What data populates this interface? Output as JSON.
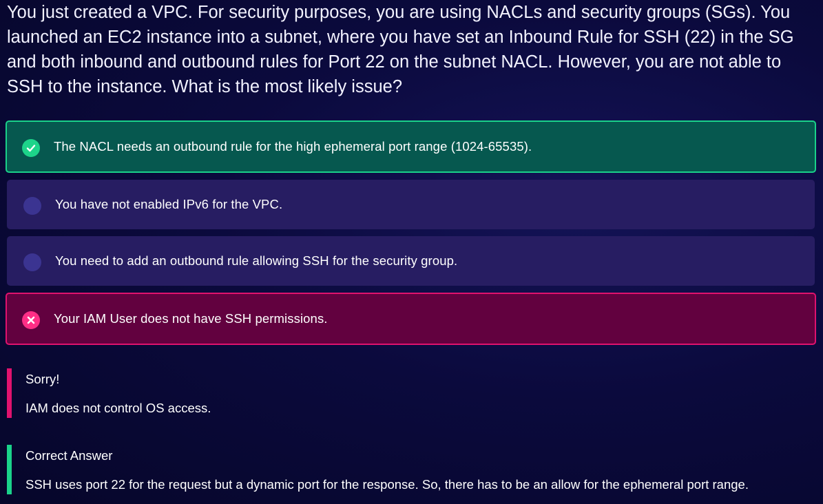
{
  "question": "You just created a VPC. For security purposes, you are using NACLs and security groups (SGs). You launched an EC2 instance into a subnet, where you have set an Inbound Rule for SSH (22) in the SG and both inbound and outbound rules for Port 22 on the subnet NACL. However, you are not able to SSH to the instance. What is the most likely issue?",
  "options": [
    {
      "text": "The NACL needs an outbound rule for the high ephemeral port range (1024-65535).",
      "state": "correct",
      "icon": "check-circle-icon"
    },
    {
      "text": "You have not enabled IPv6 for the VPC.",
      "state": "unselected",
      "icon": "radio-dot-icon"
    },
    {
      "text": "You need to add an outbound rule allowing SSH for the security group.",
      "state": "unselected",
      "icon": "radio-dot-icon"
    },
    {
      "text": "Your IAM User does not have SSH permissions.",
      "state": "wrong",
      "icon": "x-circle-icon"
    }
  ],
  "feedback": {
    "sorry_title": "Sorry!",
    "sorry_body": "IAM does not control OS access.",
    "answer_title": "Correct Answer",
    "answer_body": "SSH uses port 22 for the request but a dynamic port for the response. So, there has to be an allow for the ephemeral port range."
  },
  "colors": {
    "correct_accent": "#1ad28a",
    "wrong_accent": "#e0126e",
    "correct_bg": "#06584f",
    "wrong_bg": "#62013f",
    "neutral_bg": "#271d62"
  }
}
